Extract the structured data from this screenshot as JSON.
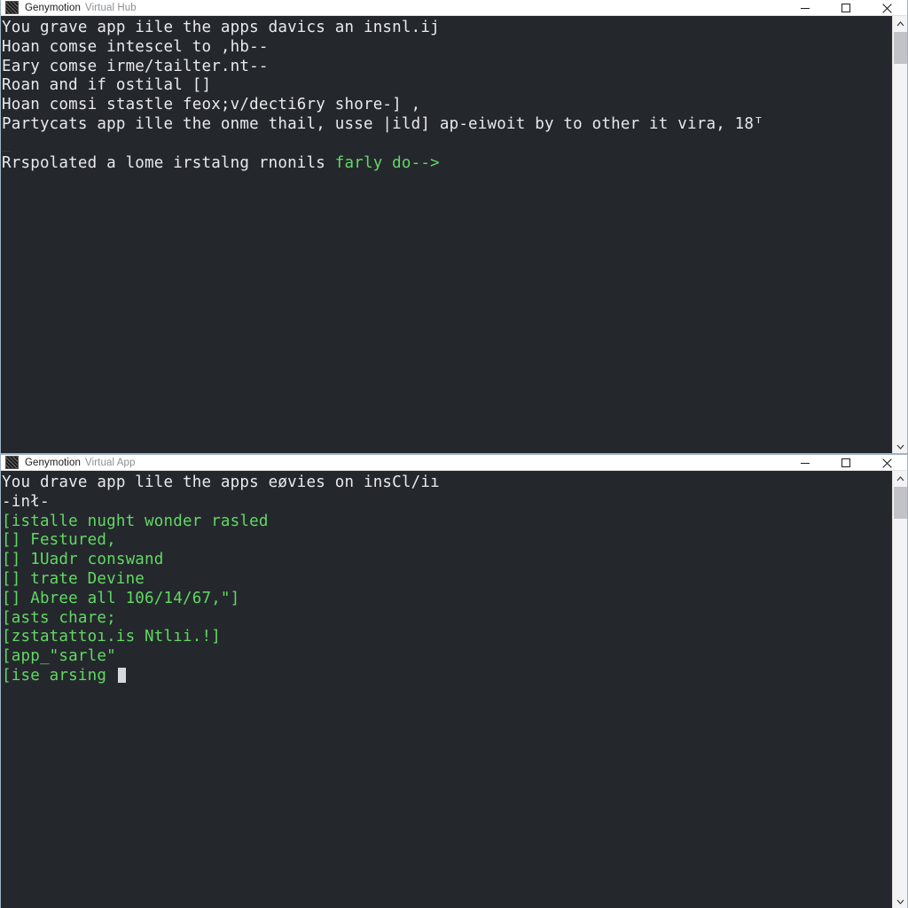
{
  "windows": [
    {
      "id": "genymotion-virtual-hub",
      "title": {
        "app": "Genymotion",
        "subtitle": "Virtual Hub"
      },
      "controls": {
        "minimize": "minimize-icon",
        "maximize": "maximize-icon",
        "close": "close-icon"
      },
      "terminal": {
        "lines": [
          {
            "text": "You grave app iile the apps davics an insnl.ij",
            "color": "white"
          },
          {
            "text": "Hoan comse intescel to ,hb--",
            "color": "white"
          },
          {
            "text": "Eary comse irme/tailter.nt--",
            "color": "white"
          },
          {
            "text": "Roan and if ostilal []",
            "color": "white"
          },
          {
            "text": "Hoan comsi stastle feox;v/decti6ry shore-] ,",
            "color": "white"
          },
          {
            "text": "Partycats app ille the onme thail, usse |ild] ap-eiwoit by to other it vira, 18ᵀ",
            "color": "white"
          },
          {
            "text": "_",
            "color": "faint"
          },
          {
            "text": "Rrspolated a lome irstalng rnonils ",
            "color": "white",
            "tail": "farly do-->",
            "tail_color": "green"
          }
        ]
      },
      "scrollbar": {
        "up_arrow": "chevron-up-icon",
        "down_arrow": "chevron-down-icon"
      }
    },
    {
      "id": "genymotion-virtual-app",
      "title": {
        "app": "Genymotion",
        "subtitle": "Virtual App"
      },
      "controls": {
        "minimize": "minimize-icon",
        "maximize": "maximize-icon",
        "close": "close-icon"
      },
      "terminal": {
        "lines": [
          {
            "text": "You drave app lile the apps eøvies on insCl/iı",
            "color": "white"
          },
          {
            "text": "-inł-",
            "color": "white"
          },
          {
            "text": "[istalle nught wonder rasled",
            "color": "green"
          },
          {
            "text": "[] Festured,",
            "color": "green"
          },
          {
            "text": "[] 1Uadr conswand",
            "color": "green"
          },
          {
            "text": "[] trate Devine",
            "color": "green"
          },
          {
            "text": "[] Abree all 106/14/67,\"]",
            "color": "green"
          },
          {
            "text": "[asts chare;",
            "color": "green"
          },
          {
            "text": "[zstatattoı.is Ntlıi.!]",
            "color": "green"
          },
          {
            "text": "[app_\"sarle\"",
            "color": "green"
          },
          {
            "text": "[ise arsing ",
            "color": "green",
            "cursor": true
          }
        ]
      },
      "scrollbar": {
        "up_arrow": "chevron-up-icon",
        "down_arrow": "chevron-down-icon"
      }
    }
  ],
  "colors": {
    "terminal_background": "#24282d",
    "terminal_text": "#e8eaec",
    "terminal_green": "#63d863",
    "titlebar_background": "#ffffff",
    "window_border": "#9fb4c6",
    "scrollbar_track": "#f3f3f3",
    "scrollbar_thumb": "#c2c3c6"
  }
}
